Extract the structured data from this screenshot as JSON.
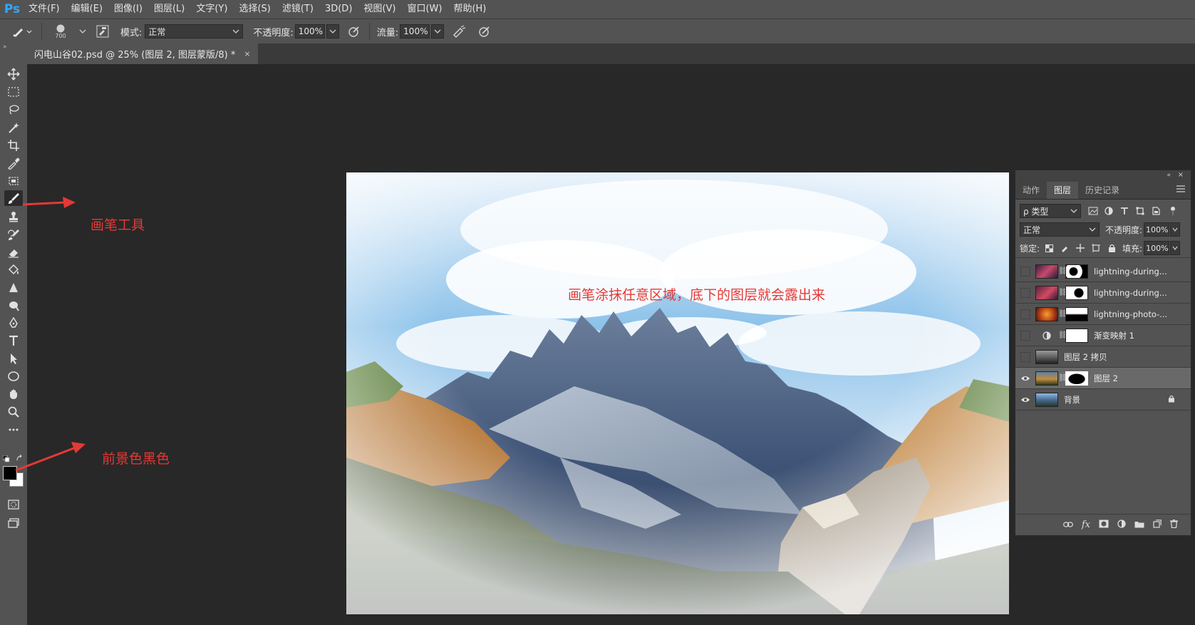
{
  "app": {
    "logo": "Ps"
  },
  "menu": [
    "文件(F)",
    "编辑(E)",
    "图像(I)",
    "图层(L)",
    "文字(Y)",
    "选择(S)",
    "滤镜(T)",
    "3D(D)",
    "视图(V)",
    "窗口(W)",
    "帮助(H)"
  ],
  "options": {
    "brush_size": "700",
    "mode_label": "模式:",
    "mode_value": "正常",
    "opacity_label": "不透明度:",
    "opacity_value": "100%",
    "flow_label": "流量:",
    "flow_value": "100%"
  },
  "document": {
    "tab_title": "闪电山谷02.psd @ 25% (图层 2, 图层蒙版/8) *",
    "close": "×"
  },
  "annotations": {
    "brush_tool": "画笔工具",
    "foreground_black": "前景色黑色",
    "canvas_note": "画笔涂抹任意区域，底下的图层就会露出来"
  },
  "panel": {
    "tabs": [
      "动作",
      "图层",
      "历史记录"
    ],
    "active_tab": "图层",
    "filter_label": "ρ 类型",
    "blend_mode": "正常",
    "opacity_label": "不透明度:",
    "opacity_value": "100%",
    "lock_label": "锁定:",
    "fill_label": "填充:",
    "fill_value": "100%",
    "layers": [
      {
        "name": "lightning-during...",
        "visible": false,
        "has_mask": true
      },
      {
        "name": "lightning-during...",
        "visible": false,
        "has_mask": true
      },
      {
        "name": "lightning-photo-...",
        "visible": false,
        "has_mask": true
      },
      {
        "name": "渐变映射 1",
        "visible": false,
        "adjustment": true
      },
      {
        "name": "图层 2 拷贝",
        "visible": false,
        "has_mask": false
      },
      {
        "name": "图层 2",
        "visible": true,
        "has_mask": true,
        "selected": true
      },
      {
        "name": "背景",
        "visible": true,
        "locked": true
      }
    ],
    "bottom_icons": [
      "link-icon",
      "fx-icon",
      "mask-icon",
      "adjustment-icon",
      "folder-icon",
      "new-layer-icon",
      "trash-icon"
    ]
  },
  "colors": {
    "accent_red": "#e53935",
    "ps_blue": "#31a8ff"
  }
}
